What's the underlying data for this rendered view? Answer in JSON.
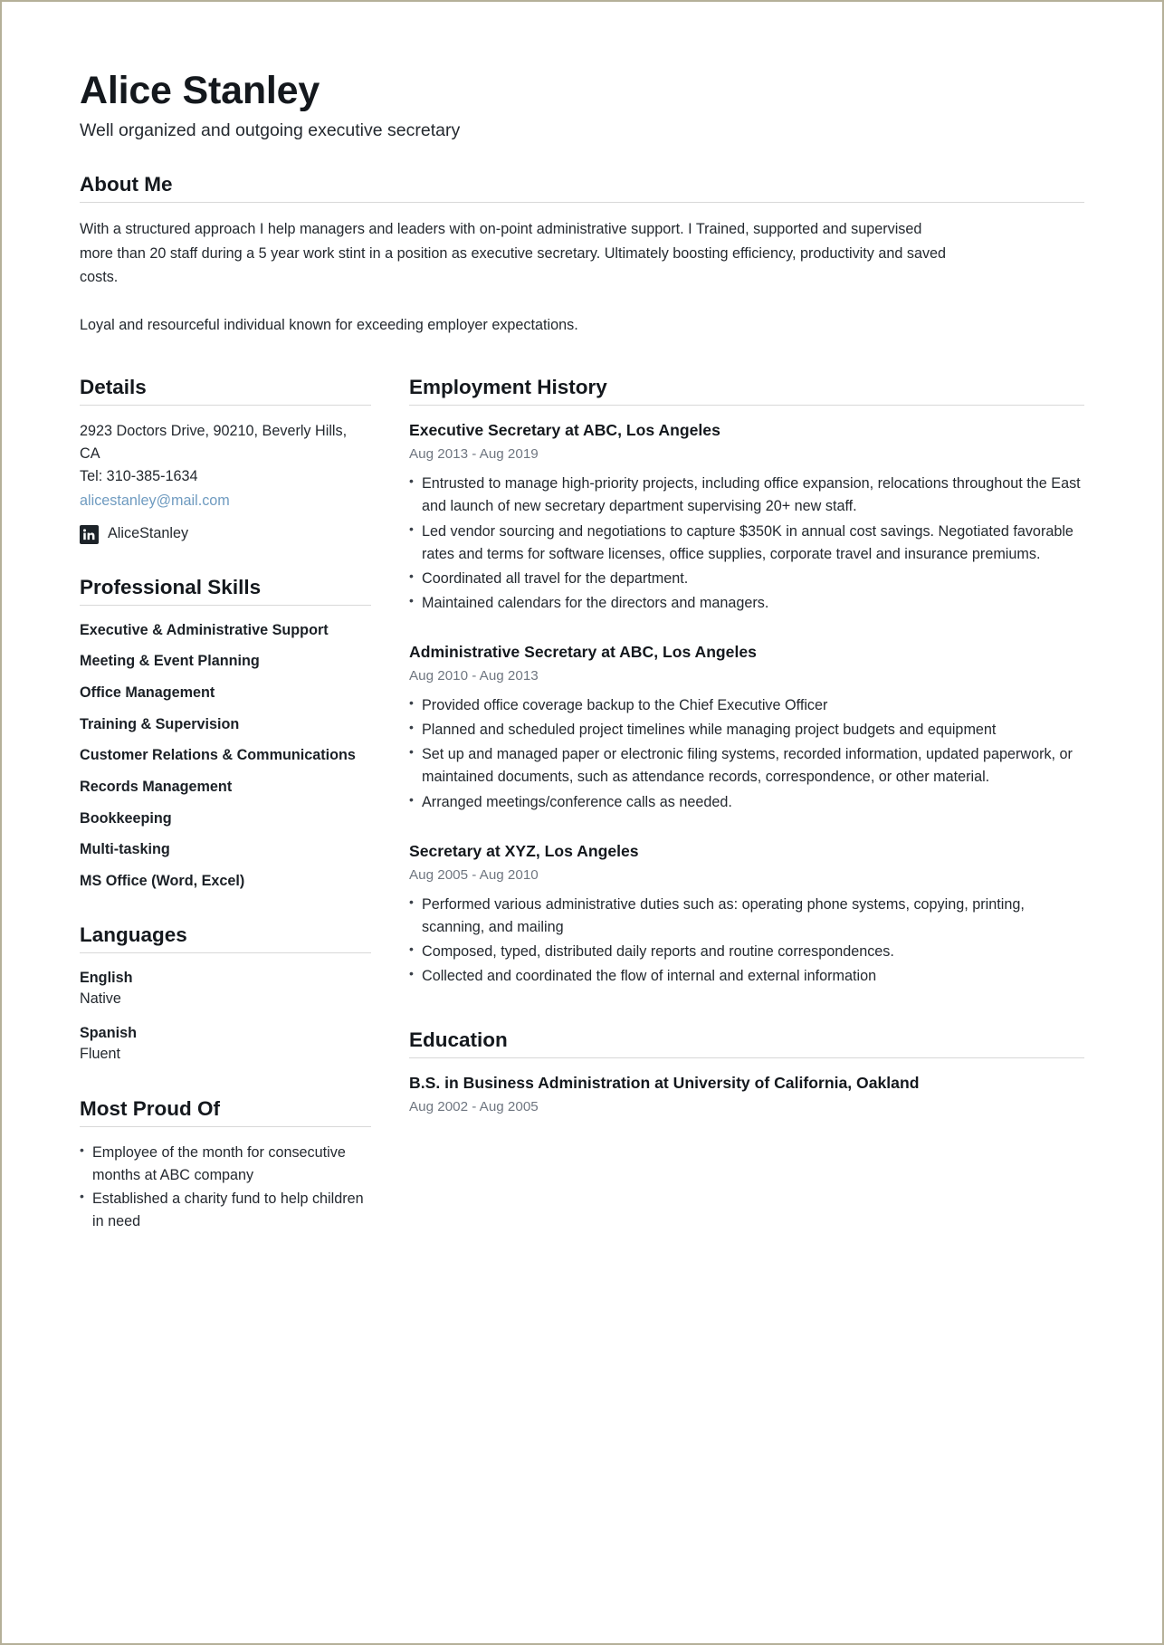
{
  "header": {
    "name": "Alice Stanley",
    "tagline": "Well organized and outgoing executive secretary"
  },
  "about": {
    "title": "About Me",
    "paragraphs": [
      "With a structured approach I help managers and leaders with on-point administrative support. I Trained, supported and supervised more than 20 staff during a 5 year work stint in a position as executive secretary. Ultimately boosting efficiency, productivity and saved costs.",
      "Loyal and resourceful individual known for exceeding employer expectations."
    ]
  },
  "details": {
    "title": "Details",
    "address": "2923 Doctors Drive, 90210, Beverly Hills, CA",
    "phone": "Tel: 310-385-1634",
    "email": "alicestanley@mail.com",
    "social": {
      "icon": "linkedin-icon",
      "handle": "AliceStanley"
    }
  },
  "skills": {
    "title": "Professional Skills",
    "items": [
      "Executive & Administrative Support",
      "Meeting & Event Planning",
      "Office Management",
      "Training & Supervision",
      "Customer Relations & Communications",
      "Records Management",
      "Bookkeeping",
      "Multi-tasking",
      "MS Office (Word, Excel)"
    ]
  },
  "languages": {
    "title": "Languages",
    "items": [
      {
        "name": "English",
        "level": "Native"
      },
      {
        "name": "Spanish",
        "level": "Fluent"
      }
    ]
  },
  "proud": {
    "title": "Most Proud Of",
    "items": [
      "Employee of the month for consecutive months at ABC company",
      "Established a charity fund to help children in need"
    ]
  },
  "employment": {
    "title": "Employment History",
    "jobs": [
      {
        "title": "Executive Secretary at ABC, Los Angeles",
        "dates": "Aug 2013 - Aug 2019",
        "bullets": [
          "Entrusted to manage high-priority projects, including office expansion, relocations throughout the East and launch of new secretary department supervising 20+ new staff.",
          "Led vendor sourcing and negotiations to capture $350K in annual cost savings. Negotiated favorable rates and terms for software licenses, office supplies, corporate travel and insurance premiums.",
          "Coordinated all travel for the department.",
          "Maintained calendars for the directors and managers."
        ]
      },
      {
        "title": "Administrative Secretary at ABC, Los Angeles",
        "dates": "Aug 2010 - Aug 2013",
        "bullets": [
          "Provided office coverage backup to the Chief Executive Officer",
          "Planned and scheduled project timelines while managing project budgets and equipment",
          "Set up and managed paper or electronic filing systems, recorded information, updated paperwork, or maintained documents, such as attendance records, correspondence, or other material.",
          "Arranged meetings/conference calls as needed."
        ]
      },
      {
        "title": "Secretary at XYZ, Los Angeles",
        "dates": "Aug 2005 - Aug 2010",
        "bullets": [
          "Performed various administrative duties such as: operating phone systems, copying, printing, scanning, and mailing",
          "Composed, typed, distributed daily reports and routine correspondences.",
          "Collected and coordinated the flow of internal and external information"
        ]
      }
    ]
  },
  "education": {
    "title": "Education",
    "entries": [
      {
        "title": "B.S. in Business Administration at University of California, Oakland",
        "dates": "Aug 2002 - Aug 2005"
      }
    ]
  },
  "colors": {
    "text": "#24292f",
    "heading": "#14181d",
    "muted": "#6f7680",
    "link": "#6f9bc0",
    "rule": "#d8d8d8",
    "page_border": "#b5b099"
  }
}
